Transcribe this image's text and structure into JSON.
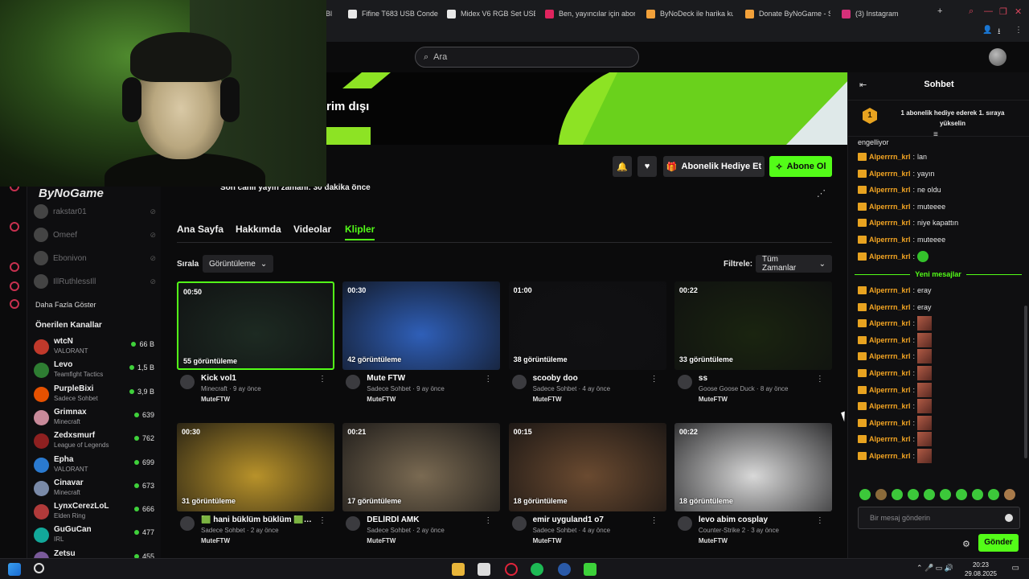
{
  "browser": {
    "tabs": [
      {
        "label": "Bl",
        "color": "#2b2b2e"
      },
      {
        "label": "Fifine T683 USB Conden",
        "color": "#e8e8e8"
      },
      {
        "label": "Midex V6 RGB Set USB",
        "color": "#e8e8e8"
      },
      {
        "label": "Ben, yayıncılar için abon",
        "color": "#e0245e"
      },
      {
        "label": "ByNoDeck ile harika ku",
        "color": "#f2a13a"
      },
      {
        "label": "Donate ByNoGame - St",
        "color": "#f2a13a"
      },
      {
        "label": "(3) Instagram",
        "color": "#d6307a"
      }
    ],
    "new_tab": "+"
  },
  "webcam": {
    "logo_text": "ByNoGame"
  },
  "header": {
    "search_placeholder": "Ara"
  },
  "banner": {
    "title": "rim dışı"
  },
  "channel": {
    "last_live": "Son canlı yayın zamanı: 30 dakika önce",
    "gift_label": "Abonelik Hediye Et",
    "subscribe_label": "Abone Ol"
  },
  "tabs": [
    {
      "label": "Ana Sayfa",
      "active": false
    },
    {
      "label": "Hakkımda",
      "active": false
    },
    {
      "label": "Videolar",
      "active": false
    },
    {
      "label": "Klipler",
      "active": true
    }
  ],
  "sort": {
    "label": "Sırala",
    "value": "Görüntüleme"
  },
  "filter": {
    "label": "Filtrele:",
    "value": "Tüm Zamanlar"
  },
  "clips": [
    {
      "duration": "00:50",
      "views": "55 görüntüleme",
      "title": "Kick vol1",
      "meta": "Minecraft · 9 ay önce",
      "author": "MuteFTW",
      "bg": "#1d2a22"
    },
    {
      "duration": "00:30",
      "views": "42 görüntüleme",
      "title": "Mute FTW",
      "meta": "Sadece Sohbet · 9 ay önce",
      "author": "MuteFTW",
      "bg": "#2f5fb8"
    },
    {
      "duration": "01:00",
      "views": "38 görüntüleme",
      "title": "scooby doo",
      "meta": "Sadece Sohbet · 4 ay önce",
      "author": "MuteFTW",
      "bg": "#111113"
    },
    {
      "duration": "00:22",
      "views": "33 görüntüleme",
      "title": "ss",
      "meta": "Goose Goose Duck · 8 ay önce",
      "author": "MuteFTW",
      "bg": "#1a2410"
    },
    {
      "duration": "00:30",
      "views": "31 görüntüleme",
      "title": "🟩 hani büklüm büklüm 🟩 a...",
      "meta": "Sadece Sohbet · 2 ay önce",
      "author": "MuteFTW",
      "bg": "#b8922a"
    },
    {
      "duration": "00:21",
      "views": "17 görüntüleme",
      "title": "DELİRDİ AMK",
      "meta": "Sadece Sohbet · 2 ay önce",
      "author": "MuteFTW",
      "bg": "#7a6a52"
    },
    {
      "duration": "00:15",
      "views": "18 görüntüleme",
      "title": "emir uyguland1 o7",
      "meta": "Sadece Sohbet · 4 ay önce",
      "author": "MuteFTW",
      "bg": "#6a4a30"
    },
    {
      "duration": "00:22",
      "views": "18 görüntüleme",
      "title": "levo abim cosplay",
      "meta": "Counter-Strike 2 · 3 ay önce",
      "author": "MuteFTW",
      "bg": "#d8d8d8"
    }
  ],
  "sidebar": {
    "muted": [
      "rakstar01",
      "Omeef",
      "Ebonivon",
      "IllRuthlessIll"
    ],
    "show_more": "Daha Fazla Göster",
    "recommended_title": "Önerilen Kanallar",
    "channels": [
      {
        "name": "wtcN",
        "game": "VALORANT",
        "viewers": "66 B",
        "color": "#c0392b"
      },
      {
        "name": "Levo",
        "game": "Teamfight Tactics",
        "viewers": "1,5 B",
        "color": "#2e7d32"
      },
      {
        "name": "PurpleBixi",
        "game": "Sadece Sohbet",
        "viewers": "3,9 B",
        "color": "#e65100"
      },
      {
        "name": "Grimnax",
        "game": "Minecraft",
        "viewers": "639",
        "color": "#c88a9a"
      },
      {
        "name": "Zedxsmurf",
        "game": "League of Legends",
        "viewers": "762",
        "color": "#8e2020"
      },
      {
        "name": "Epha",
        "game": "VALORANT",
        "viewers": "699",
        "color": "#2a7ad0"
      },
      {
        "name": "Cinavar",
        "game": "Minecraft",
        "viewers": "673",
        "color": "#7a8aa8"
      },
      {
        "name": "LynxCerezLoL",
        "game": "Elden Ring",
        "viewers": "666",
        "color": "#b03a3a"
      },
      {
        "name": "GuGuCan",
        "game": "IRL",
        "viewers": "477",
        "color": "#12a89a"
      },
      {
        "name": "Zetsu",
        "game": "",
        "viewers": "455",
        "color": "#7a5a9a"
      }
    ]
  },
  "chat": {
    "title": "Sohbet",
    "leader_rank": "1",
    "leader_text": "1 abonelik hediye ederek 1. sıraya yükselin",
    "top_partial": "engelliyor",
    "messages": [
      {
        "user": "Alperrrn_krl",
        "text": "lan",
        "emote": ""
      },
      {
        "user": "Alperrrn_krl",
        "text": "yayın",
        "emote": ""
      },
      {
        "user": "Alperrrn_krl",
        "text": "ne oldu",
        "emote": ""
      },
      {
        "user": "Alperrrn_krl",
        "text": "muteeee",
        "emote": ""
      },
      {
        "user": "Alperrrn_krl",
        "text": "niye kapattın",
        "emote": ""
      },
      {
        "user": "Alperrrn_krl",
        "text": "muteeee",
        "emote": ""
      },
      {
        "user": "Alperrrn_krl",
        "text": "",
        "emote": "green"
      }
    ],
    "new_messages_label": "Yeni mesajlar",
    "new_messages": [
      {
        "user": "Alperrrn_krl",
        "text": "eray",
        "emote": ""
      },
      {
        "user": "Alperrrn_krl",
        "text": "eray",
        "emote": ""
      },
      {
        "user": "Alperrrn_krl",
        "text": "",
        "emote": "photo"
      },
      {
        "user": "Alperrrn_krl",
        "text": "",
        "emote": "photo"
      },
      {
        "user": "Alperrrn_krl",
        "text": "",
        "emote": "photo"
      },
      {
        "user": "Alperrrn_krl",
        "text": "",
        "emote": "photo"
      },
      {
        "user": "Alperrrn_krl",
        "text": "",
        "emote": "photo"
      },
      {
        "user": "Alperrrn_krl",
        "text": "",
        "emote": "photo"
      },
      {
        "user": "Alperrrn_krl",
        "text": "",
        "emote": "photo"
      },
      {
        "user": "Alperrrn_krl",
        "text": "",
        "emote": "photo"
      },
      {
        "user": "Alperrrn_krl",
        "text": "",
        "emote": "photo"
      }
    ],
    "input_placeholder": "Bir mesaj gönderin",
    "send_label": "Gönder"
  },
  "taskbar": {
    "time": "20:23",
    "date": "29.08.2025"
  }
}
